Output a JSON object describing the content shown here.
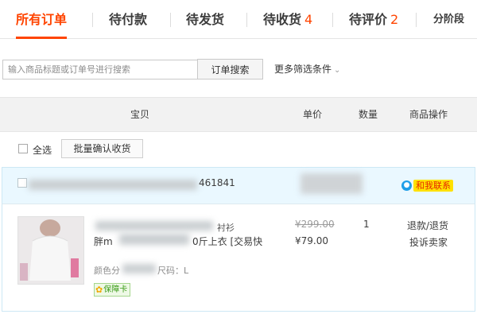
{
  "tabs": [
    {
      "label": "所有订单",
      "count": ""
    },
    {
      "label": "待付款",
      "count": ""
    },
    {
      "label": "待发货",
      "count": ""
    },
    {
      "label": "待收货",
      "count": "4"
    },
    {
      "label": "待评价",
      "count": "2"
    },
    {
      "label": "分阶段",
      "count": ""
    }
  ],
  "search": {
    "placeholder": "输入商品标题或订单号进行搜索",
    "button_label": "订单搜索",
    "more_filters_label": "更多筛选条件",
    "chevron": "⌄"
  },
  "table_header": {
    "product": "宝贝",
    "unit_price": "单价",
    "quantity": "数量",
    "actions": "商品操作"
  },
  "toolbar": {
    "select_all_label": "全选",
    "batch_confirm_label": "批量确认收货"
  },
  "order": {
    "order_number_fragment": "461841",
    "wangwang_label": "和我联系",
    "item": {
      "title_fragment_1": "衬衫",
      "title_fragment_2_prefix": "胖m",
      "title_fragment_2": "0斤上衣 [交易快",
      "spec_prefix": "颜色分",
      "spec_suffix": "尺码：L",
      "badge_label": "保障卡",
      "original_price": "¥299.00",
      "current_price": "¥79.00",
      "quantity": "1",
      "action_refund": "退款/退货",
      "action_complain": "投诉卖家"
    }
  },
  "colors": {
    "accent": "#ff4400",
    "order_header_bg": "#eaf8ff",
    "wangwang_blue": "#1f9ee8",
    "wangwang_yellow": "#ffe100",
    "badge_green": "#3b9c18"
  }
}
